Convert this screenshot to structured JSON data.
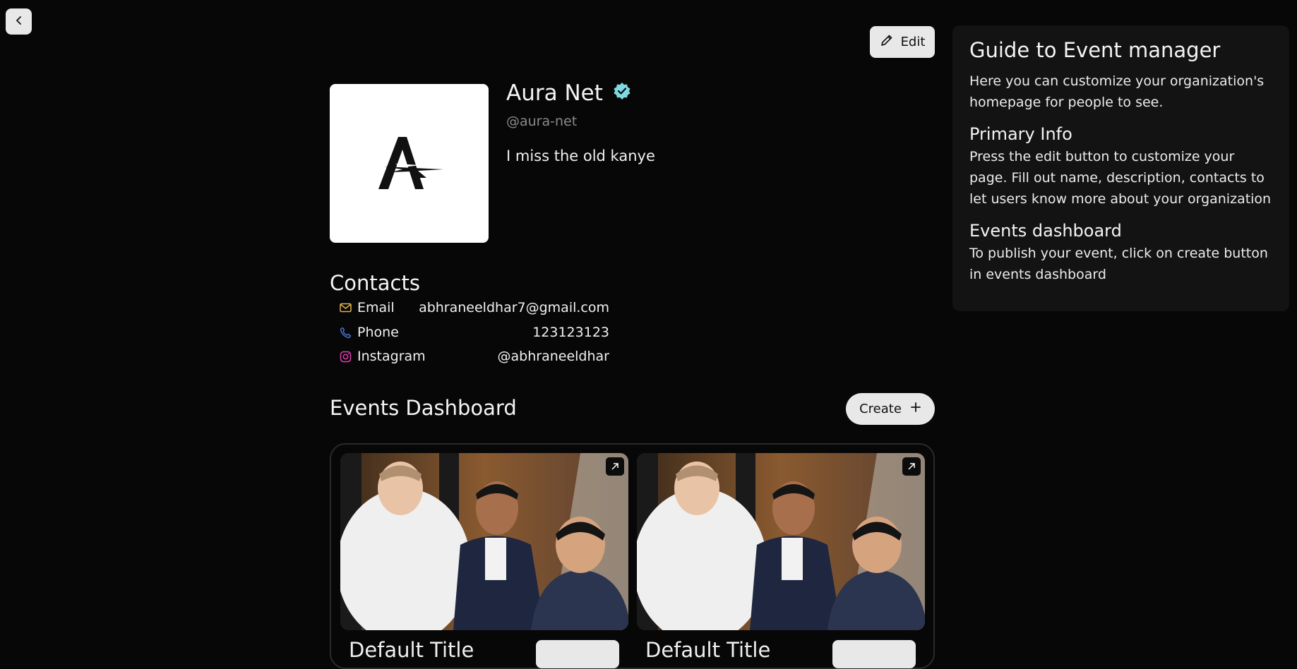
{
  "header": {
    "back_icon": "chevron-left-icon",
    "edit_label": "Edit",
    "edit_icon": "pencil-icon"
  },
  "profile": {
    "name": "Aura Net",
    "verified_icon": "verified-badge-icon",
    "handle": "@aura-net",
    "description": "I miss the old kanye",
    "logo_icon": "aura-logo-icon"
  },
  "contacts": {
    "title": "Contacts",
    "items": [
      {
        "icon": "mail-icon",
        "label": "Email",
        "value": "abhraneeldhar7@gmail.com",
        "color": "#e0b34a"
      },
      {
        "icon": "phone-icon",
        "label": "Phone",
        "value": "123123123",
        "color": "#4a7de0"
      },
      {
        "icon": "instagram-icon",
        "label": "Instagram",
        "value": "@abhraneeldhar",
        "color": "#e040b0"
      }
    ]
  },
  "events": {
    "title": "Events Dashboard",
    "create_label": "Create",
    "create_icon": "plus-icon",
    "cards": [
      {
        "title": "Default Title",
        "image": "event-photo",
        "expand_icon": "expand-arrow-icon"
      },
      {
        "title": "Default Title",
        "image": "event-photo",
        "expand_icon": "expand-arrow-icon"
      }
    ]
  },
  "guide": {
    "title": "Guide to Event manager",
    "intro": "Here you can customize your organization's homepage for people to see.",
    "sections": [
      {
        "heading": "Primary Info",
        "text": "Press the edit button to customize your page. Fill out name, description, contacts to let users know more about your organization"
      },
      {
        "heading": "Events dashboard",
        "text": "To publish your event, click on create button in events dashboard"
      }
    ]
  },
  "colors": {
    "background": "#070707",
    "button_bg": "#e8e8e8",
    "verified": "#7fd9e0",
    "panel": "#131313"
  }
}
